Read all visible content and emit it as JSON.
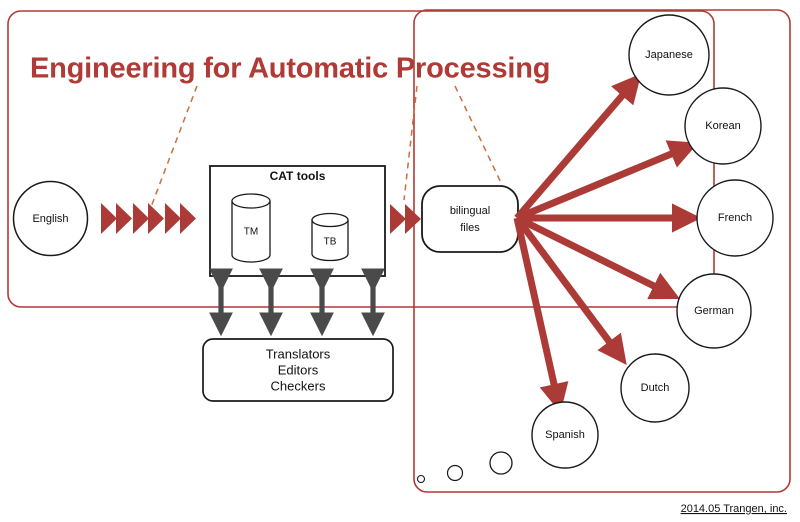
{
  "diagram": {
    "title": "Engineering for Automatic Processing",
    "footer": "2014.05 Trangen, inc.",
    "colors": {
      "accent_red": "#B03A36",
      "arrow_red": "#AC3B37",
      "dashed_orange": "#C8703C",
      "stroke_black": "#1A1A1A",
      "double_arrow_gray": "#4A4A4A",
      "background": "#FFFFFF"
    },
    "source": {
      "label": "English"
    },
    "cat_tools": {
      "title": "CAT tools",
      "stores": [
        {
          "label": "TM"
        },
        {
          "label": "TB"
        }
      ]
    },
    "bilingual": {
      "label_line1": "bilingual",
      "label_line2": "files"
    },
    "roles": {
      "lines": [
        "Translators",
        "Editors",
        "Checkers"
      ]
    },
    "targets": [
      {
        "label": "Japanese"
      },
      {
        "label": "Korean"
      },
      {
        "label": "French"
      },
      {
        "label": "German"
      },
      {
        "label": "Dutch"
      },
      {
        "label": "Spanish"
      }
    ],
    "small_circles": [
      {
        "label": ""
      },
      {
        "label": ""
      },
      {
        "label": ""
      }
    ]
  }
}
